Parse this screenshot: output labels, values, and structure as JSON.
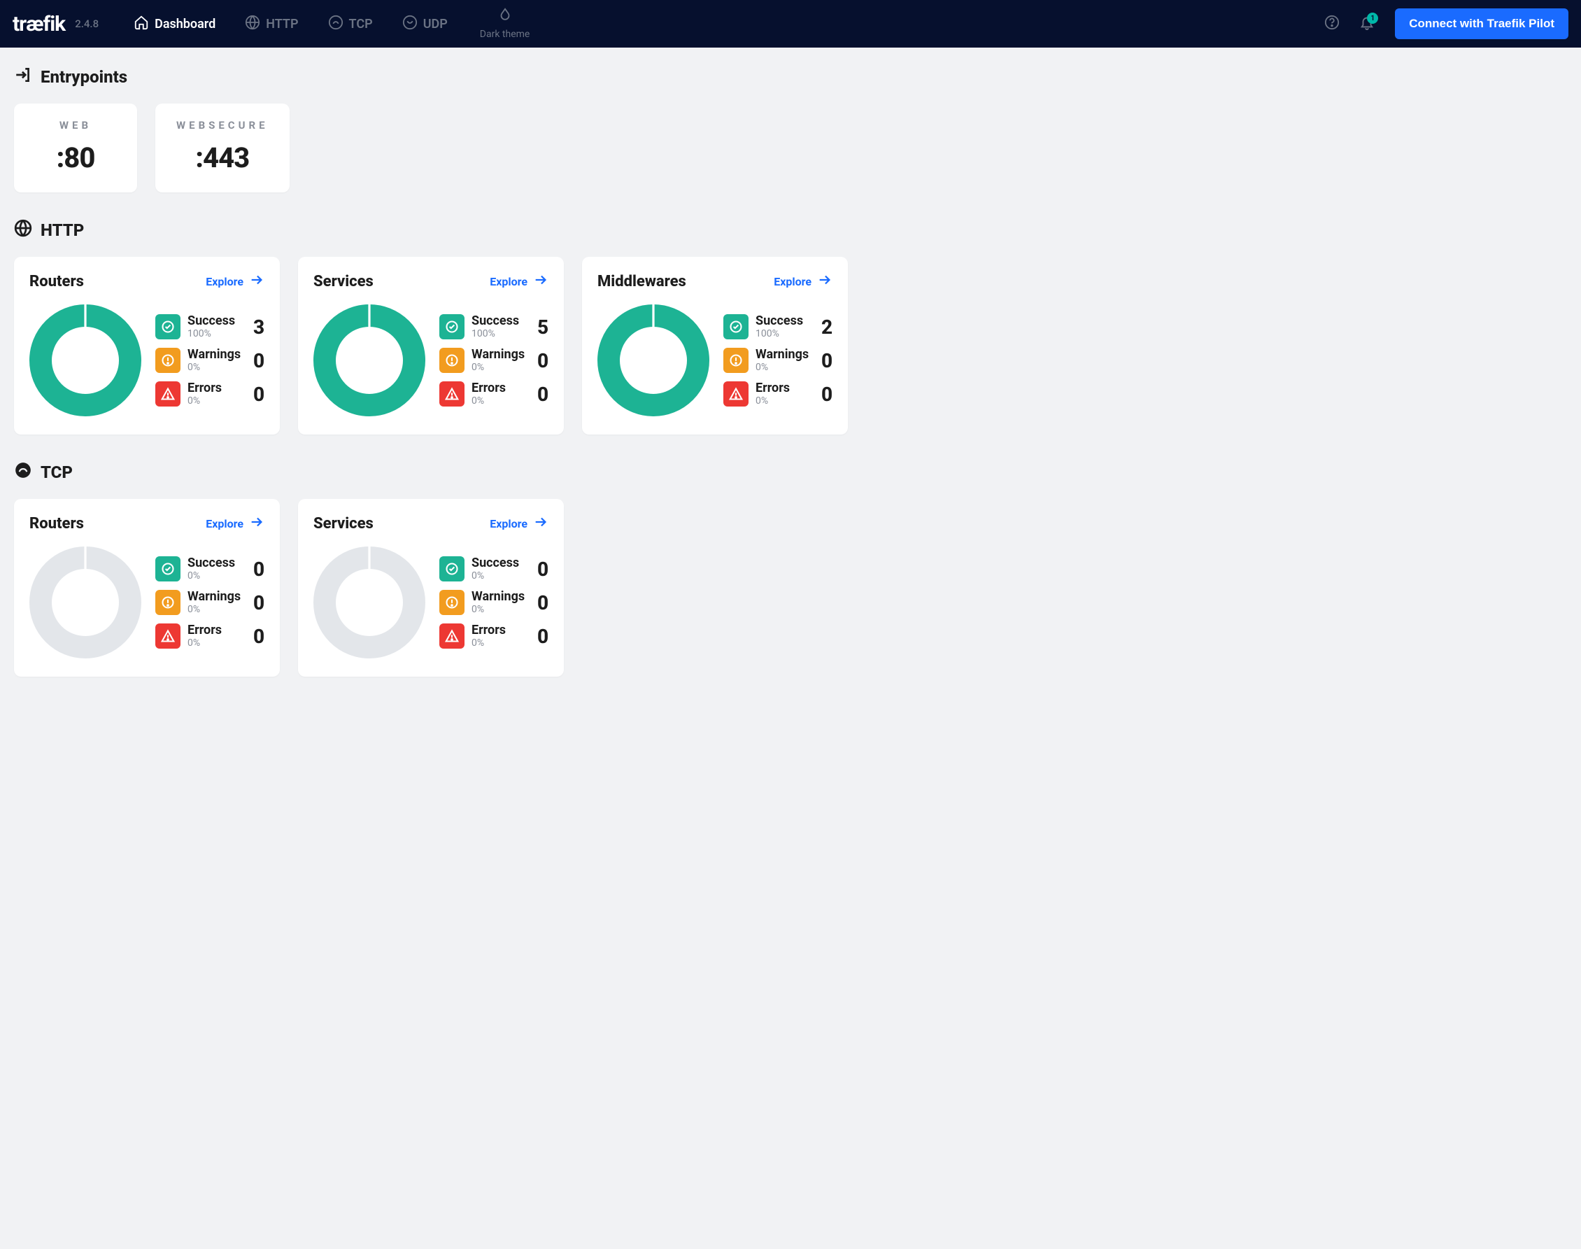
{
  "header": {
    "logo_text": "træfik",
    "version": "2.4.8",
    "nav": {
      "dashboard": "Dashboard",
      "http": "HTTP",
      "tcp": "TCP",
      "udp": "UDP"
    },
    "theme_label": "Dark theme",
    "notification_badge": "1",
    "connect_label": "Connect with Traefik Pilot"
  },
  "sections": {
    "entrypoints_title": "Entrypoints",
    "http_title": "HTTP",
    "tcp_title": "TCP"
  },
  "entrypoints": [
    {
      "name": "WEB",
      "port": ":80"
    },
    {
      "name": "WEBSECURE",
      "port": ":443"
    }
  ],
  "labels": {
    "explore": "Explore",
    "success": "Success",
    "warnings": "Warnings",
    "errors": "Errors"
  },
  "colors": {
    "success": "#1db394",
    "warning": "#f29c1f",
    "error": "#ed3833",
    "empty": "#e3e6ea",
    "accent": "#1a6bff"
  },
  "http_panels": [
    {
      "title": "Routers",
      "success_pct": "100%",
      "success_count": "3",
      "warn_pct": "0%",
      "warn_count": "0",
      "err_pct": "0%",
      "err_count": "0",
      "ring": "full"
    },
    {
      "title": "Services",
      "success_pct": "100%",
      "success_count": "5",
      "warn_pct": "0%",
      "warn_count": "0",
      "err_pct": "0%",
      "err_count": "0",
      "ring": "full"
    },
    {
      "title": "Middlewares",
      "success_pct": "100%",
      "success_count": "2",
      "warn_pct": "0%",
      "warn_count": "0",
      "err_pct": "0%",
      "err_count": "0",
      "ring": "full"
    }
  ],
  "tcp_panels": [
    {
      "title": "Routers",
      "success_pct": "0%",
      "success_count": "0",
      "warn_pct": "0%",
      "warn_count": "0",
      "err_pct": "0%",
      "err_count": "0",
      "ring": "empty"
    },
    {
      "title": "Services",
      "success_pct": "0%",
      "success_count": "0",
      "warn_pct": "0%",
      "warn_count": "0",
      "err_pct": "0%",
      "err_count": "0",
      "ring": "empty"
    }
  ],
  "chart_data": [
    {
      "type": "pie",
      "title": "HTTP Routers",
      "categories": [
        "Success",
        "Warnings",
        "Errors"
      ],
      "values": [
        3,
        0,
        0
      ]
    },
    {
      "type": "pie",
      "title": "HTTP Services",
      "categories": [
        "Success",
        "Warnings",
        "Errors"
      ],
      "values": [
        5,
        0,
        0
      ]
    },
    {
      "type": "pie",
      "title": "HTTP Middlewares",
      "categories": [
        "Success",
        "Warnings",
        "Errors"
      ],
      "values": [
        2,
        0,
        0
      ]
    },
    {
      "type": "pie",
      "title": "TCP Routers",
      "categories": [
        "Success",
        "Warnings",
        "Errors"
      ],
      "values": [
        0,
        0,
        0
      ]
    },
    {
      "type": "pie",
      "title": "TCP Services",
      "categories": [
        "Success",
        "Warnings",
        "Errors"
      ],
      "values": [
        0,
        0,
        0
      ]
    }
  ]
}
